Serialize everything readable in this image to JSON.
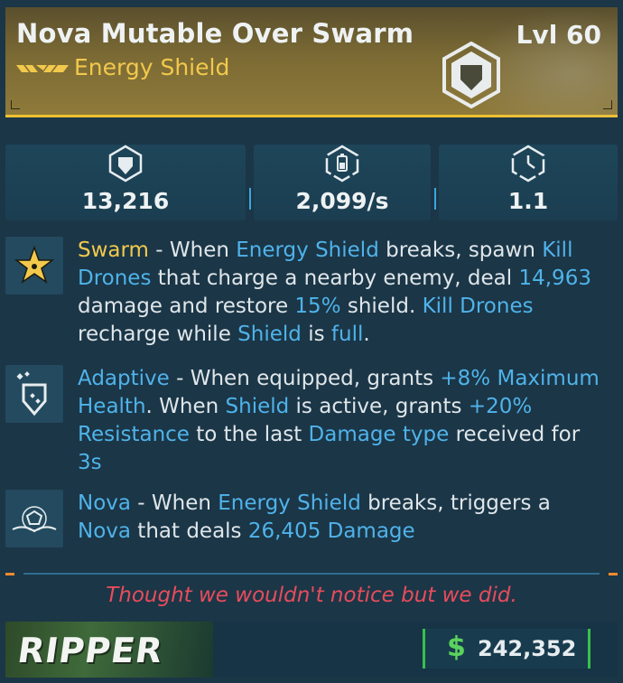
{
  "item": {
    "name": "Nova Mutable Over Swarm",
    "level": "Lvl 60",
    "type": "Energy Shield",
    "rarity_icon": "triple-chevron-icon",
    "emblem_icon": "shield-emblem-icon"
  },
  "stats": [
    {
      "icon": "shield-capacity-icon",
      "value": "13,216"
    },
    {
      "icon": "recharge-rate-icon",
      "value": "2,099/s"
    },
    {
      "icon": "recharge-delay-icon",
      "value": "1.1"
    }
  ],
  "perks": [
    {
      "icon": "swarm-star-icon",
      "segments": [
        {
          "t": "Swarm",
          "c": "gold"
        },
        {
          "t": " - When ",
          "c": ""
        },
        {
          "t": "Energy Shield",
          "c": "kw"
        },
        {
          "t": " breaks, spawn ",
          "c": ""
        },
        {
          "t": "Kill Drones",
          "c": "kw"
        },
        {
          "t": " that charge a nearby enemy, deal ",
          "c": ""
        },
        {
          "t": "14,963",
          "c": "kw"
        },
        {
          "t": " damage and restore ",
          "c": ""
        },
        {
          "t": "15%",
          "c": "kw"
        },
        {
          "t": " shield. ",
          "c": ""
        },
        {
          "t": "Kill Drones",
          "c": "kw"
        },
        {
          "t": " recharge while ",
          "c": ""
        },
        {
          "t": "Shield",
          "c": "kw"
        },
        {
          "t": " is ",
          "c": ""
        },
        {
          "t": "full",
          "c": "kw"
        },
        {
          "t": ".",
          "c": ""
        }
      ]
    },
    {
      "icon": "adaptive-shield-icon",
      "segments": [
        {
          "t": "Adaptive",
          "c": "kw"
        },
        {
          "t": " - When equipped, grants ",
          "c": ""
        },
        {
          "t": "+8% Maximum Health",
          "c": "kw"
        },
        {
          "t": ". When ",
          "c": ""
        },
        {
          "t": "Shield",
          "c": "kw"
        },
        {
          "t": " is active, grants ",
          "c": ""
        },
        {
          "t": "+20% Resistance",
          "c": "kw"
        },
        {
          "t": " to the last ",
          "c": ""
        },
        {
          "t": "Damage type",
          "c": "kw"
        },
        {
          "t": " received for ",
          "c": ""
        },
        {
          "t": "3s",
          "c": "kw"
        }
      ]
    },
    {
      "icon": "nova-burst-icon",
      "segments": [
        {
          "t": "Nova",
          "c": "kw"
        },
        {
          "t": " - When ",
          "c": ""
        },
        {
          "t": "Energy Shield",
          "c": "kw"
        },
        {
          "t": " breaks, triggers a ",
          "c": ""
        },
        {
          "t": "Nova",
          "c": "kw"
        },
        {
          "t": " that deals ",
          "c": ""
        },
        {
          "t": "26,405 Damage",
          "c": "kw"
        }
      ]
    }
  ],
  "flavor_text": "Thought we wouldn't notice but we did.",
  "manufacturer": "RIPPER",
  "price": {
    "currency_icon": "$",
    "value": "242,352"
  },
  "colors": {
    "header_gold": "#f2c94c",
    "keyword_blue": "#4fb3ea",
    "flavor_red": "#e84c5c",
    "price_green": "#38c04a"
  }
}
